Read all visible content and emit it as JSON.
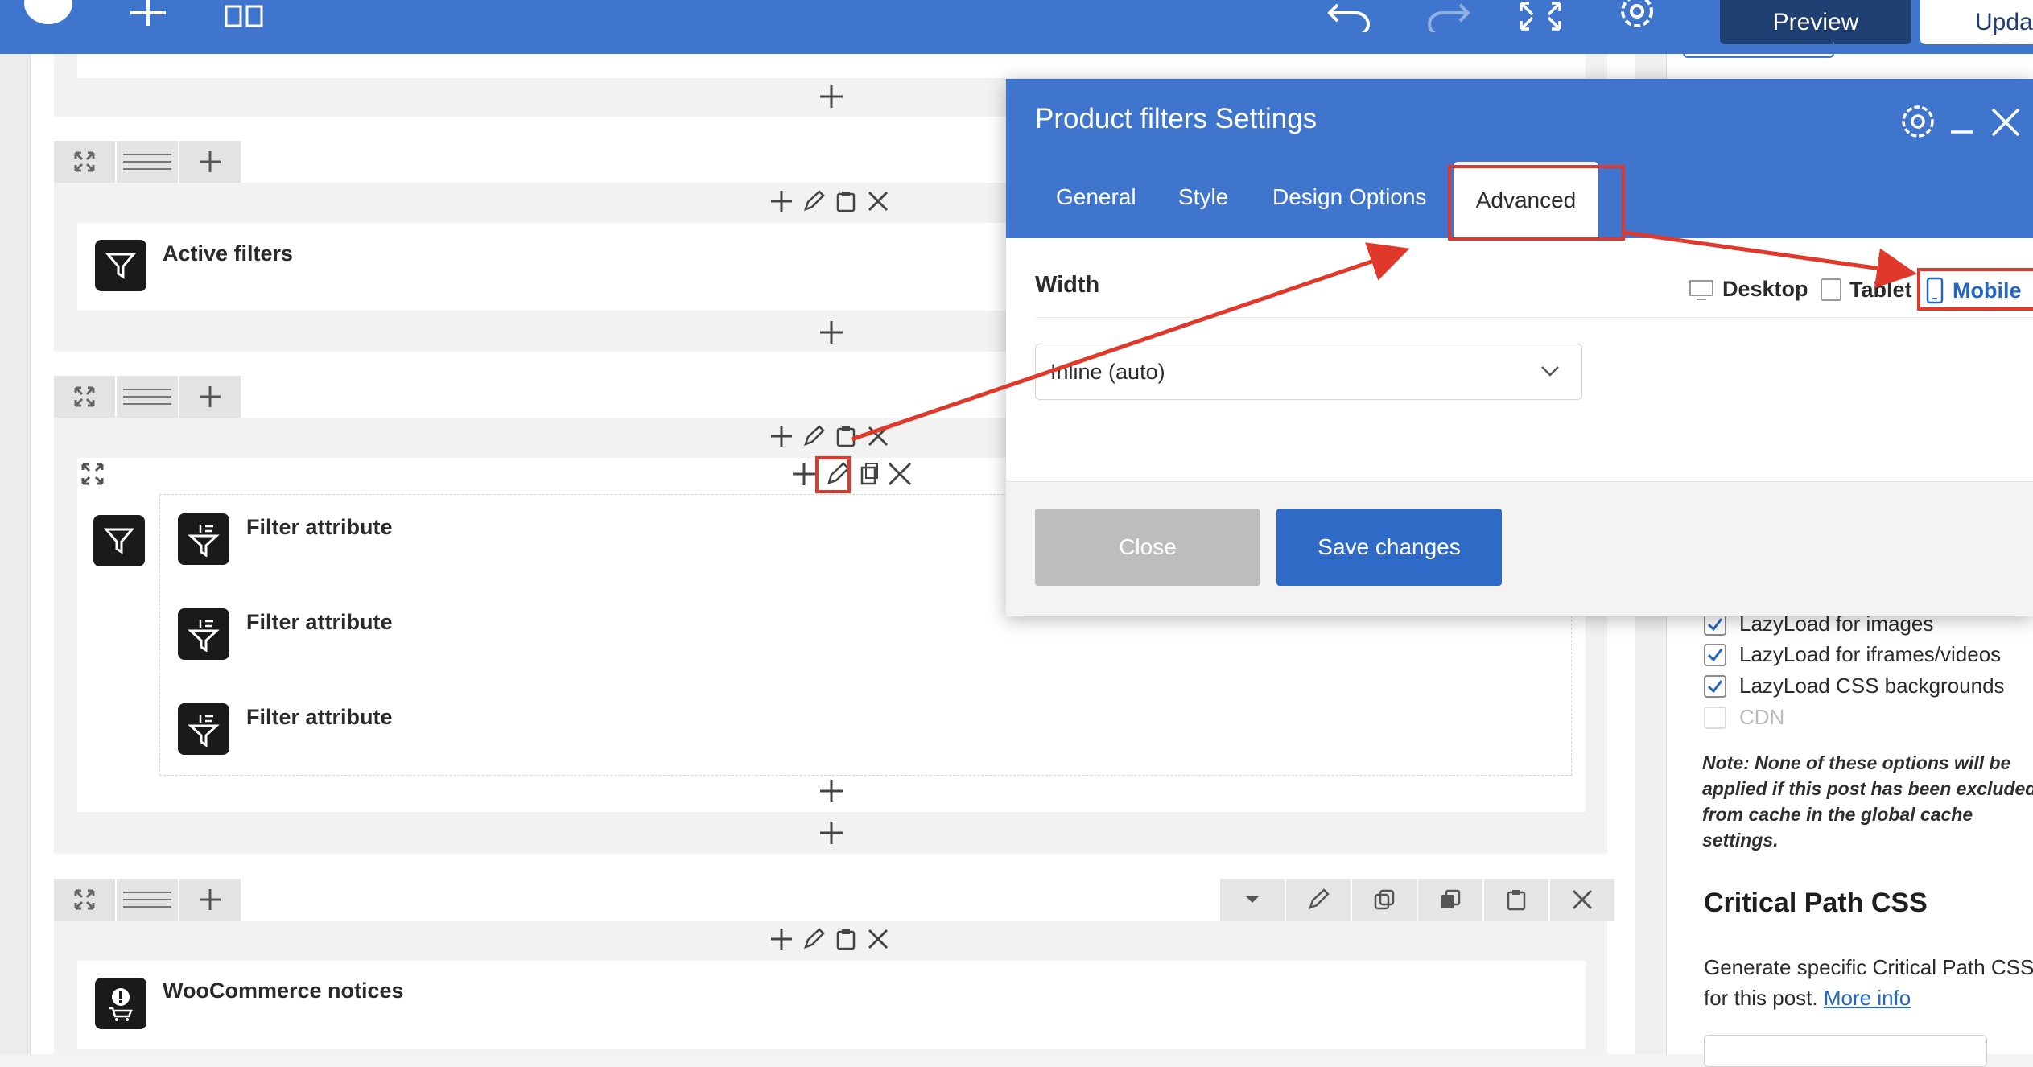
{
  "toolbar": {
    "preview_label": "Preview",
    "update_label": "Upda"
  },
  "canvas": {
    "rows": [
      {
        "element": "Active filters"
      },
      {
        "elements": [
          "Filter attribute",
          "Filter attribute",
          "Filter attribute"
        ]
      },
      {
        "element": "WooCommerce notices"
      }
    ]
  },
  "modal": {
    "title": "Product filters Settings",
    "tabs": [
      "General",
      "Style",
      "Design Options",
      "Advanced"
    ],
    "active_tab": "Advanced",
    "width_label": "Width",
    "devices": [
      "Desktop",
      "Tablet",
      "Mobile"
    ],
    "active_device": "Mobile",
    "width_select_value": "Inline (auto)",
    "close_label": "Close",
    "save_label": "Save changes"
  },
  "sidebar": {
    "options": [
      {
        "label": "LazyLoad for images",
        "checked": true
      },
      {
        "label": "LazyLoad for iframes/videos",
        "checked": true
      },
      {
        "label": "LazyLoad CSS backgrounds",
        "checked": true
      },
      {
        "label": "CDN",
        "checked": false
      }
    ],
    "note": "Note: None of these options will be applied if this post has been excluded from cache in the global cache settings.",
    "critical_heading": "Critical Path CSS",
    "critical_text": "Generate specific Critical Path CSS for this post.",
    "more_info_label": "More info"
  },
  "colors": {
    "brand_blue": "#3f75cc",
    "highlight_red": "#e0392b",
    "link_blue": "#2366c4"
  }
}
